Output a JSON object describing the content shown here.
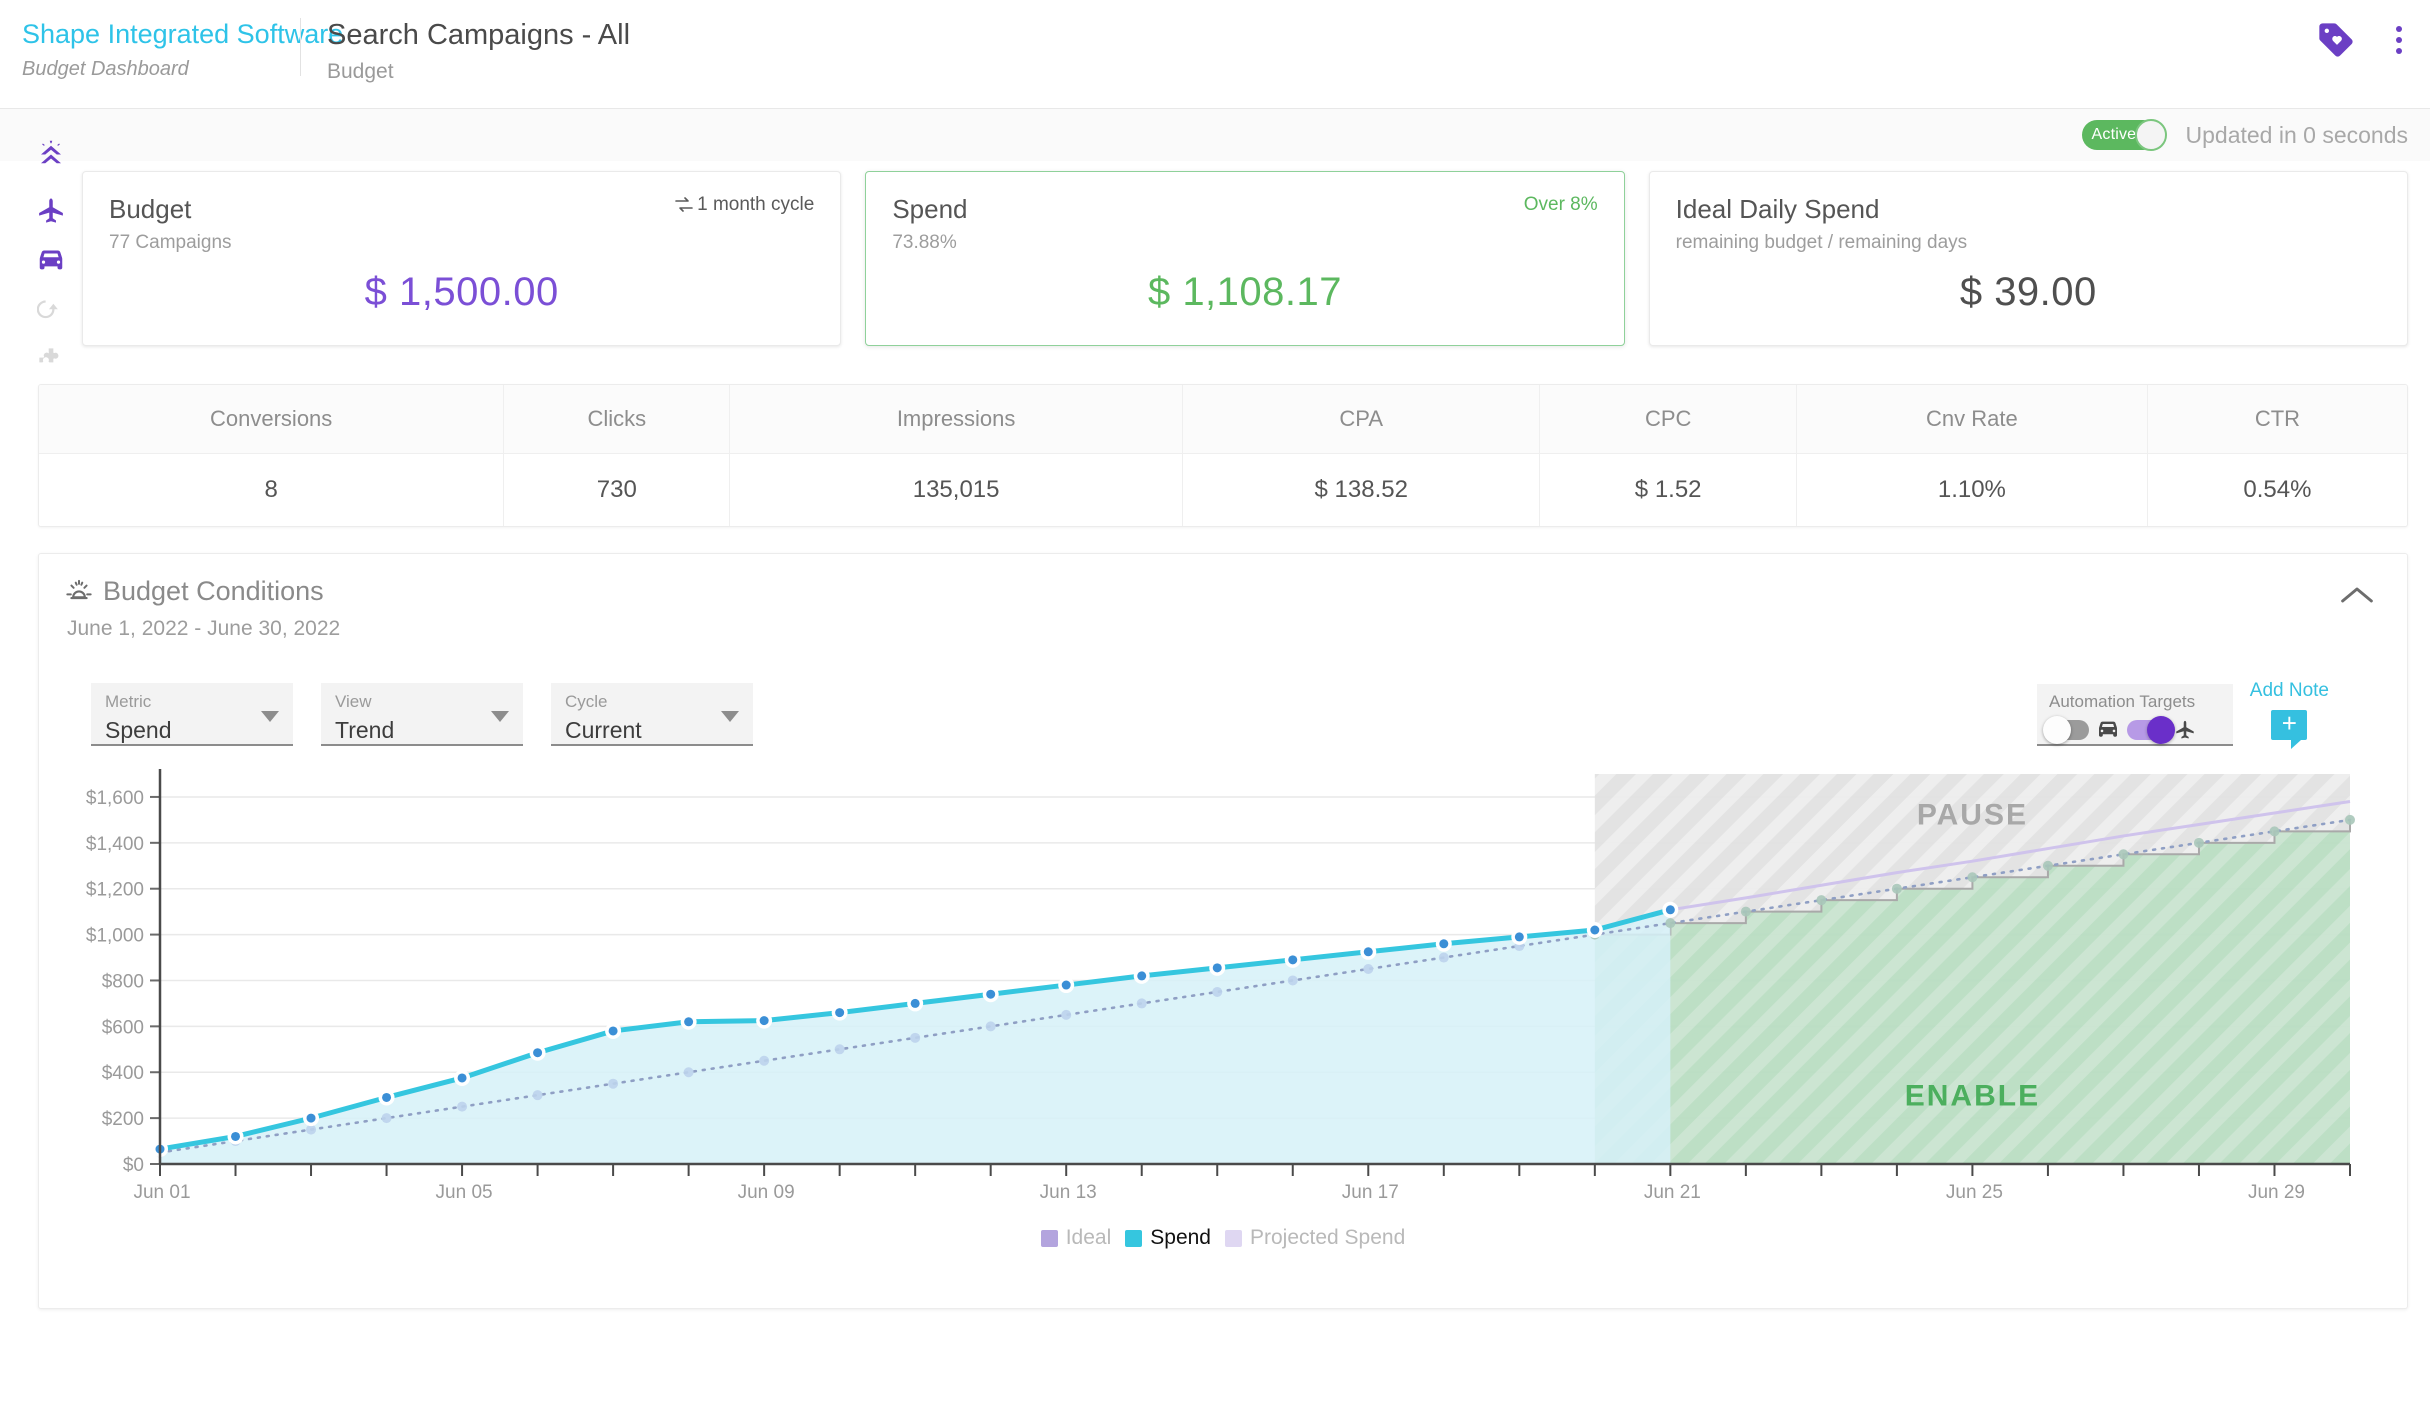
{
  "header": {
    "brand": "Shape Integrated Software",
    "brand_sub": "Budget Dashboard",
    "title": "Search Campaigns - All",
    "subtitle": "Budget",
    "tag_icon": "tag-heart-icon",
    "menu_icon": "kebab-menu-icon"
  },
  "status": {
    "toggle_label": "Active",
    "updated": "Updated in 0 seconds"
  },
  "rail": {
    "items": [
      {
        "name": "shape-rocket-icon",
        "active": true
      },
      {
        "name": "airplane-icon",
        "active": true
      },
      {
        "name": "car-icon",
        "active": true
      },
      {
        "name": "refresh-icon",
        "active": false
      },
      {
        "name": "puzzle-icon",
        "active": false
      }
    ]
  },
  "cards": [
    {
      "title": "Budget",
      "sub": "77 Campaigns",
      "note": "1 month cycle",
      "note_icon": "cycle-icon",
      "value": "$ 1,500.00",
      "value_color": "#7b4fd6"
    },
    {
      "title": "Spend",
      "sub": "73.88%",
      "note": "Over 8%",
      "value": "$ 1,108.17",
      "value_color": "#5cb85f"
    },
    {
      "title": "Ideal Daily Spend",
      "sub": "remaining budget / remaining days",
      "note": "",
      "value": "$ 39.00",
      "value_color": "#4f4f4f"
    }
  ],
  "metrics": {
    "headers": [
      "Conversions",
      "Clicks",
      "Impressions",
      "CPA",
      "CPC",
      "Cnv Rate",
      "CTR"
    ],
    "values": [
      "8",
      "730",
      "135,015",
      "$ 138.52",
      "$ 1.52",
      "1.10%",
      "0.54%"
    ]
  },
  "conditions": {
    "title": "Budget Conditions",
    "title_icon": "sun-icon",
    "dates": "June 1, 2022  -  June 30, 2022",
    "collapse_icon": "chevron-up-icon"
  },
  "controls": {
    "selects": [
      {
        "label": "Metric",
        "value": "Spend"
      },
      {
        "label": "View",
        "value": "Trend"
      },
      {
        "label": "Cycle",
        "value": "Current"
      }
    ],
    "automation": {
      "label": "Automation Targets",
      "toggles": [
        {
          "icon": "car-icon",
          "state": "off"
        },
        {
          "icon": "airplane-icon",
          "state": "on"
        }
      ]
    },
    "add_note": {
      "label": "Add Note",
      "icon": "note-plus-icon"
    }
  },
  "chart_data": {
    "type": "area",
    "title": "",
    "xlabel": "",
    "ylabel": "",
    "ylim": [
      0,
      1700
    ],
    "ytick_labels": [
      "$0",
      "$200",
      "$400",
      "$600",
      "$800",
      "$1,000",
      "$1,200",
      "$1,400",
      "$1,600"
    ],
    "ytick_values": [
      0,
      200,
      400,
      600,
      800,
      1000,
      1200,
      1400,
      1600
    ],
    "grid": true,
    "legend_position": "bottom",
    "x": [
      "Jun 01",
      "Jun 02",
      "Jun 03",
      "Jun 04",
      "Jun 05",
      "Jun 06",
      "Jun 07",
      "Jun 08",
      "Jun 09",
      "Jun 10",
      "Jun 11",
      "Jun 12",
      "Jun 13",
      "Jun 14",
      "Jun 15",
      "Jun 16",
      "Jun 17",
      "Jun 18",
      "Jun 19",
      "Jun 20",
      "Jun 21",
      "Jun 22",
      "Jun 23",
      "Jun 24",
      "Jun 25",
      "Jun 26",
      "Jun 27",
      "Jun 28",
      "Jun 29",
      "Jun 30"
    ],
    "xtick_labels": [
      "Jun 01",
      "Jun 05",
      "Jun 09",
      "Jun 13",
      "Jun 17",
      "Jun 21",
      "Jun 25",
      "Jun 29"
    ],
    "series": [
      {
        "name": "Spend",
        "color": "#35c6df",
        "values": [
          65,
          120,
          200,
          290,
          375,
          485,
          580,
          620,
          625,
          660,
          700,
          740,
          780,
          820,
          855,
          890,
          925,
          960,
          990,
          1020,
          1108,
          null,
          null,
          null,
          null,
          null,
          null,
          null,
          null,
          null
        ]
      },
      {
        "name": "Ideal",
        "color": "#9b86d8",
        "values": [
          50,
          100,
          150,
          200,
          250,
          300,
          350,
          400,
          450,
          500,
          550,
          600,
          650,
          700,
          750,
          800,
          850,
          900,
          950,
          1000,
          1050,
          1100,
          1150,
          1200,
          1250,
          1300,
          1350,
          1400,
          1450,
          1500
        ]
      },
      {
        "name": "Projected Spend",
        "color": "#cfc3ec",
        "values": [
          null,
          null,
          null,
          null,
          null,
          null,
          null,
          null,
          null,
          null,
          null,
          null,
          null,
          null,
          null,
          null,
          null,
          null,
          null,
          1020,
          1108,
          1160,
          1215,
          1270,
          1320,
          1375,
          1430,
          1480,
          1530,
          1580
        ]
      }
    ],
    "zones": [
      {
        "label": "PAUSE",
        "color": "#d9d9d9",
        "text_color": "#a8a8a8"
      },
      {
        "label": "ENABLE",
        "color": "#8fcb9b",
        "text_color": "#4caf5e"
      }
    ],
    "zone_start_x": "Jun 20",
    "legend": [
      {
        "label": "Ideal",
        "color": "#b3a4de",
        "state": "muted"
      },
      {
        "label": "Spend",
        "color": "#35c6df",
        "state": "active"
      },
      {
        "label": "Projected Spend",
        "color": "#dfd7f2",
        "state": "muted"
      }
    ]
  }
}
